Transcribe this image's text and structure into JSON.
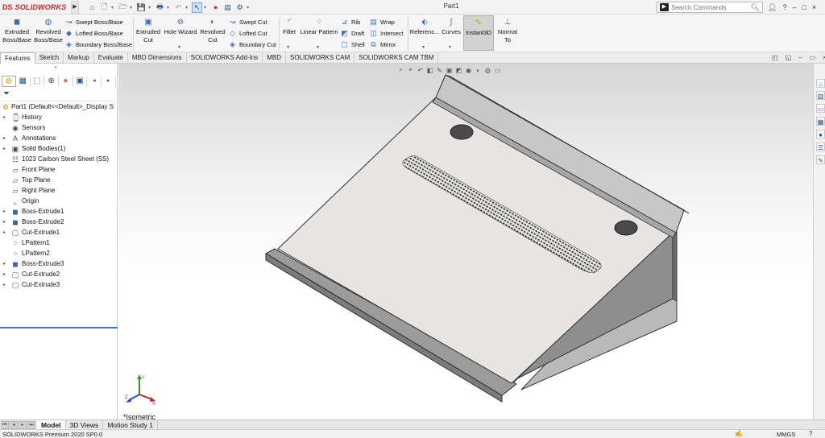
{
  "app": {
    "brand_prefix": "DS",
    "brand": "SOLIDWORKS",
    "doc_title": "Part1",
    "accent_color": "#d2231f"
  },
  "quick_access": {
    "icons": [
      "home-icon",
      "new-document-icon",
      "open-icon",
      "save-icon",
      "print-icon",
      "undo-icon",
      "select-icon",
      "rebuild-icon",
      "file-properties-icon",
      "options-icon"
    ]
  },
  "search": {
    "placeholder": "Search Commands"
  },
  "titlebar_controls": {
    "user_icon": "user-icon",
    "help": "?",
    "minimize": "–",
    "restore": "□",
    "close": "×"
  },
  "features_toolbar": {
    "extruded_boss": "Extruded Boss/Base",
    "extruded_boss_l1": "Extruded",
    "extruded_boss_l2": "Boss/Base",
    "revolved_boss_l1": "Revolved",
    "revolved_boss_l2": "Boss/Base",
    "swept_boss": "Swept Boss/Base",
    "lofted_boss": "Lofted Boss/Base",
    "boundary_boss": "Boundary Boss/Base",
    "extruded_cut_l1": "Extruded",
    "extruded_cut_l2": "Cut",
    "hole_wizard": "Hole Wizard",
    "revolved_cut_l1": "Revolved",
    "revolved_cut_l2": "Cut",
    "swept_cut": "Swept Cut",
    "lofted_cut": "Lofted Cut",
    "boundary_cut": "Boundary Cut",
    "fillet": "Fillet",
    "linear_pattern": "Linear Pattern",
    "rib": "Rib",
    "draft": "Draft",
    "shell": "Shell",
    "wrap": "Wrap",
    "intersect": "Intersect",
    "mirror": "Mirror",
    "reference": "Referenc...",
    "curves": "Curves",
    "instant3d": "Instant3D",
    "normal_to_l1": "Normal",
    "normal_to_l2": "To"
  },
  "command_tabs": [
    "Features",
    "Sketch",
    "Markup",
    "Evaluate",
    "MBD Dimensions",
    "SOLIDWORKS Add-Ins",
    "MBD",
    "SOLIDWORKS CAM",
    "SOLIDWORKS CAM TBM"
  ],
  "active_command_tab": "Features",
  "feature_tree": {
    "root": "Part1  (Default<<Default>_Display S",
    "items": [
      {
        "label": "History",
        "icon": "history-icon",
        "expandable": true
      },
      {
        "label": "Sensors",
        "icon": "sensors-icon",
        "expandable": false
      },
      {
        "label": "Annotations",
        "icon": "annotations-icon",
        "expandable": true
      },
      {
        "label": "Solid Bodies(1)",
        "icon": "solid-bodies-icon",
        "expandable": true
      },
      {
        "label": "1023 Carbon Steel Sheet (SS)",
        "icon": "material-icon",
        "expandable": false
      },
      {
        "label": "Front Plane",
        "icon": "plane-icon",
        "expandable": false
      },
      {
        "label": "Top Plane",
        "icon": "plane-icon",
        "expandable": false
      },
      {
        "label": "Right Plane",
        "icon": "plane-icon",
        "expandable": false
      },
      {
        "label": "Origin",
        "icon": "origin-icon",
        "expandable": false
      },
      {
        "label": "Boss-Extrude1",
        "icon": "boss-extrude-icon",
        "expandable": true
      },
      {
        "label": "Boss-Extrude2",
        "icon": "boss-extrude-icon",
        "expandable": true
      },
      {
        "label": "Cut-Extrude1",
        "icon": "cut-extrude-icon",
        "expandable": true
      },
      {
        "label": "LPattern1",
        "icon": "linear-pattern-icon",
        "expandable": false
      },
      {
        "label": "LPattern2",
        "icon": "linear-pattern-icon",
        "expandable": false
      },
      {
        "label": "Boss-Extrude3",
        "icon": "boss-extrude-icon",
        "expandable": true
      },
      {
        "label": "Cut-Extrude2",
        "icon": "cut-extrude-icon",
        "expandable": true
      },
      {
        "label": "Cut-Extrude3",
        "icon": "cut-extrude-icon",
        "expandable": true
      }
    ]
  },
  "viewport": {
    "view_name": "*Isometric",
    "triad_axes": [
      "X",
      "Y",
      "Z"
    ]
  },
  "bottom_tabs": [
    "Model",
    "3D Views",
    "Motion Study 1"
  ],
  "active_bottom_tab": "Model",
  "status": {
    "text": "SOLIDWORKS Premium 2020 SP0.0",
    "units": "MMGS",
    "help": "?"
  }
}
